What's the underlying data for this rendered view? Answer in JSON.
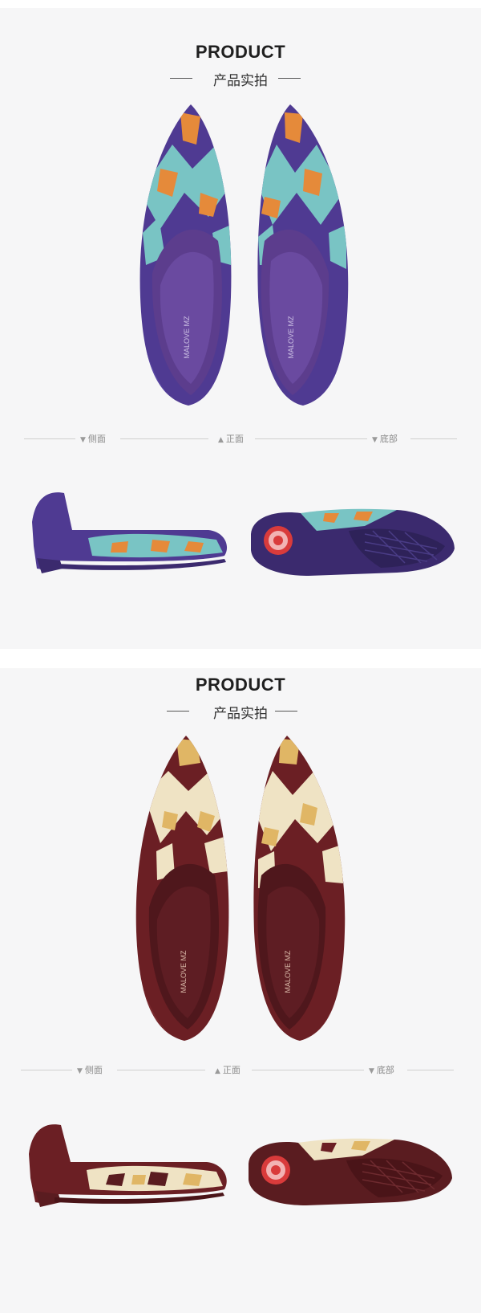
{
  "sections": [
    {
      "title": "PRODUCT",
      "subtitle": "产品实拍",
      "views": {
        "side": "侧面",
        "front": "正面",
        "bottom": "底部"
      },
      "insole_brand": "MALOVE MZ",
      "colors": {
        "base": "#4f3a92",
        "inner": "#5c3d8d",
        "pattern_a": "#79c4c4",
        "pattern_b": "#e58a3a",
        "sole": "#3b2a6e"
      }
    },
    {
      "title": "PRODUCT",
      "subtitle": "产品实拍",
      "views": {
        "side": "侧面",
        "front": "正面",
        "bottom": "底部"
      },
      "insole_brand": "MALOVE MZ",
      "colors": {
        "base": "#6b1f24",
        "inner": "#5a1e24",
        "pattern_a": "#efe3c4",
        "pattern_b": "#e0b665",
        "sole": "#5a1c20"
      }
    }
  ]
}
